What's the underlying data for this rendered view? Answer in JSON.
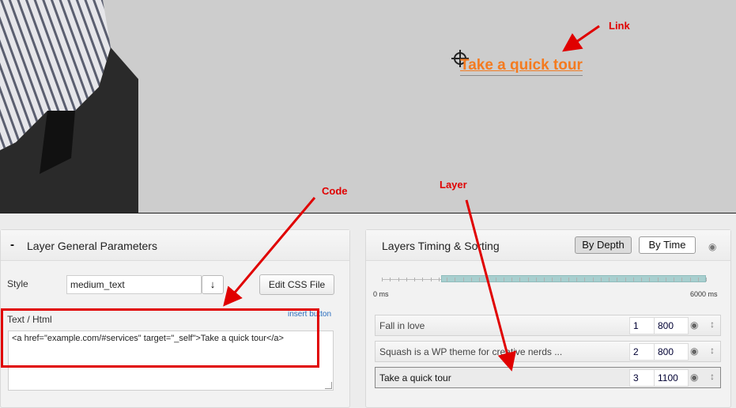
{
  "preview": {
    "link_text": "Take a quick tour"
  },
  "annotations": {
    "link": "Link",
    "code": "Code",
    "layer": "Layer"
  },
  "general_params": {
    "collapse": "-",
    "title": "Layer General Parameters",
    "style_label": "Style",
    "style_value": "medium_text",
    "download_icon": "↓",
    "edit_css_label": "Edit CSS File",
    "insert_button_label": "insert button",
    "text_html_label": "Text / Html",
    "text_html_value": "<a  href=\"example.com/#services\" target=\"_self\">Take a quick tour</a>"
  },
  "timing": {
    "title": "Layers Timing & Sorting",
    "by_depth": "By Depth",
    "by_time": "By Time",
    "timeline_start": "0 ms",
    "timeline_end": "6000 ms",
    "layers": [
      {
        "name": "Fall in love",
        "depth": "1",
        "time": "800"
      },
      {
        "name": "Squash is a WP theme for creative nerds  ...",
        "depth": "2",
        "time": "800"
      },
      {
        "name": "Take a quick tour",
        "depth": "3",
        "time": "1100"
      }
    ]
  },
  "icons": {
    "eye": "eye-icon",
    "sort": "sort-handle-icon",
    "crosshair": "crosshair-icon"
  },
  "colors": {
    "link": "#f47b20",
    "annotation": "#e00000",
    "timeline_fill": "#a8cfcf"
  }
}
